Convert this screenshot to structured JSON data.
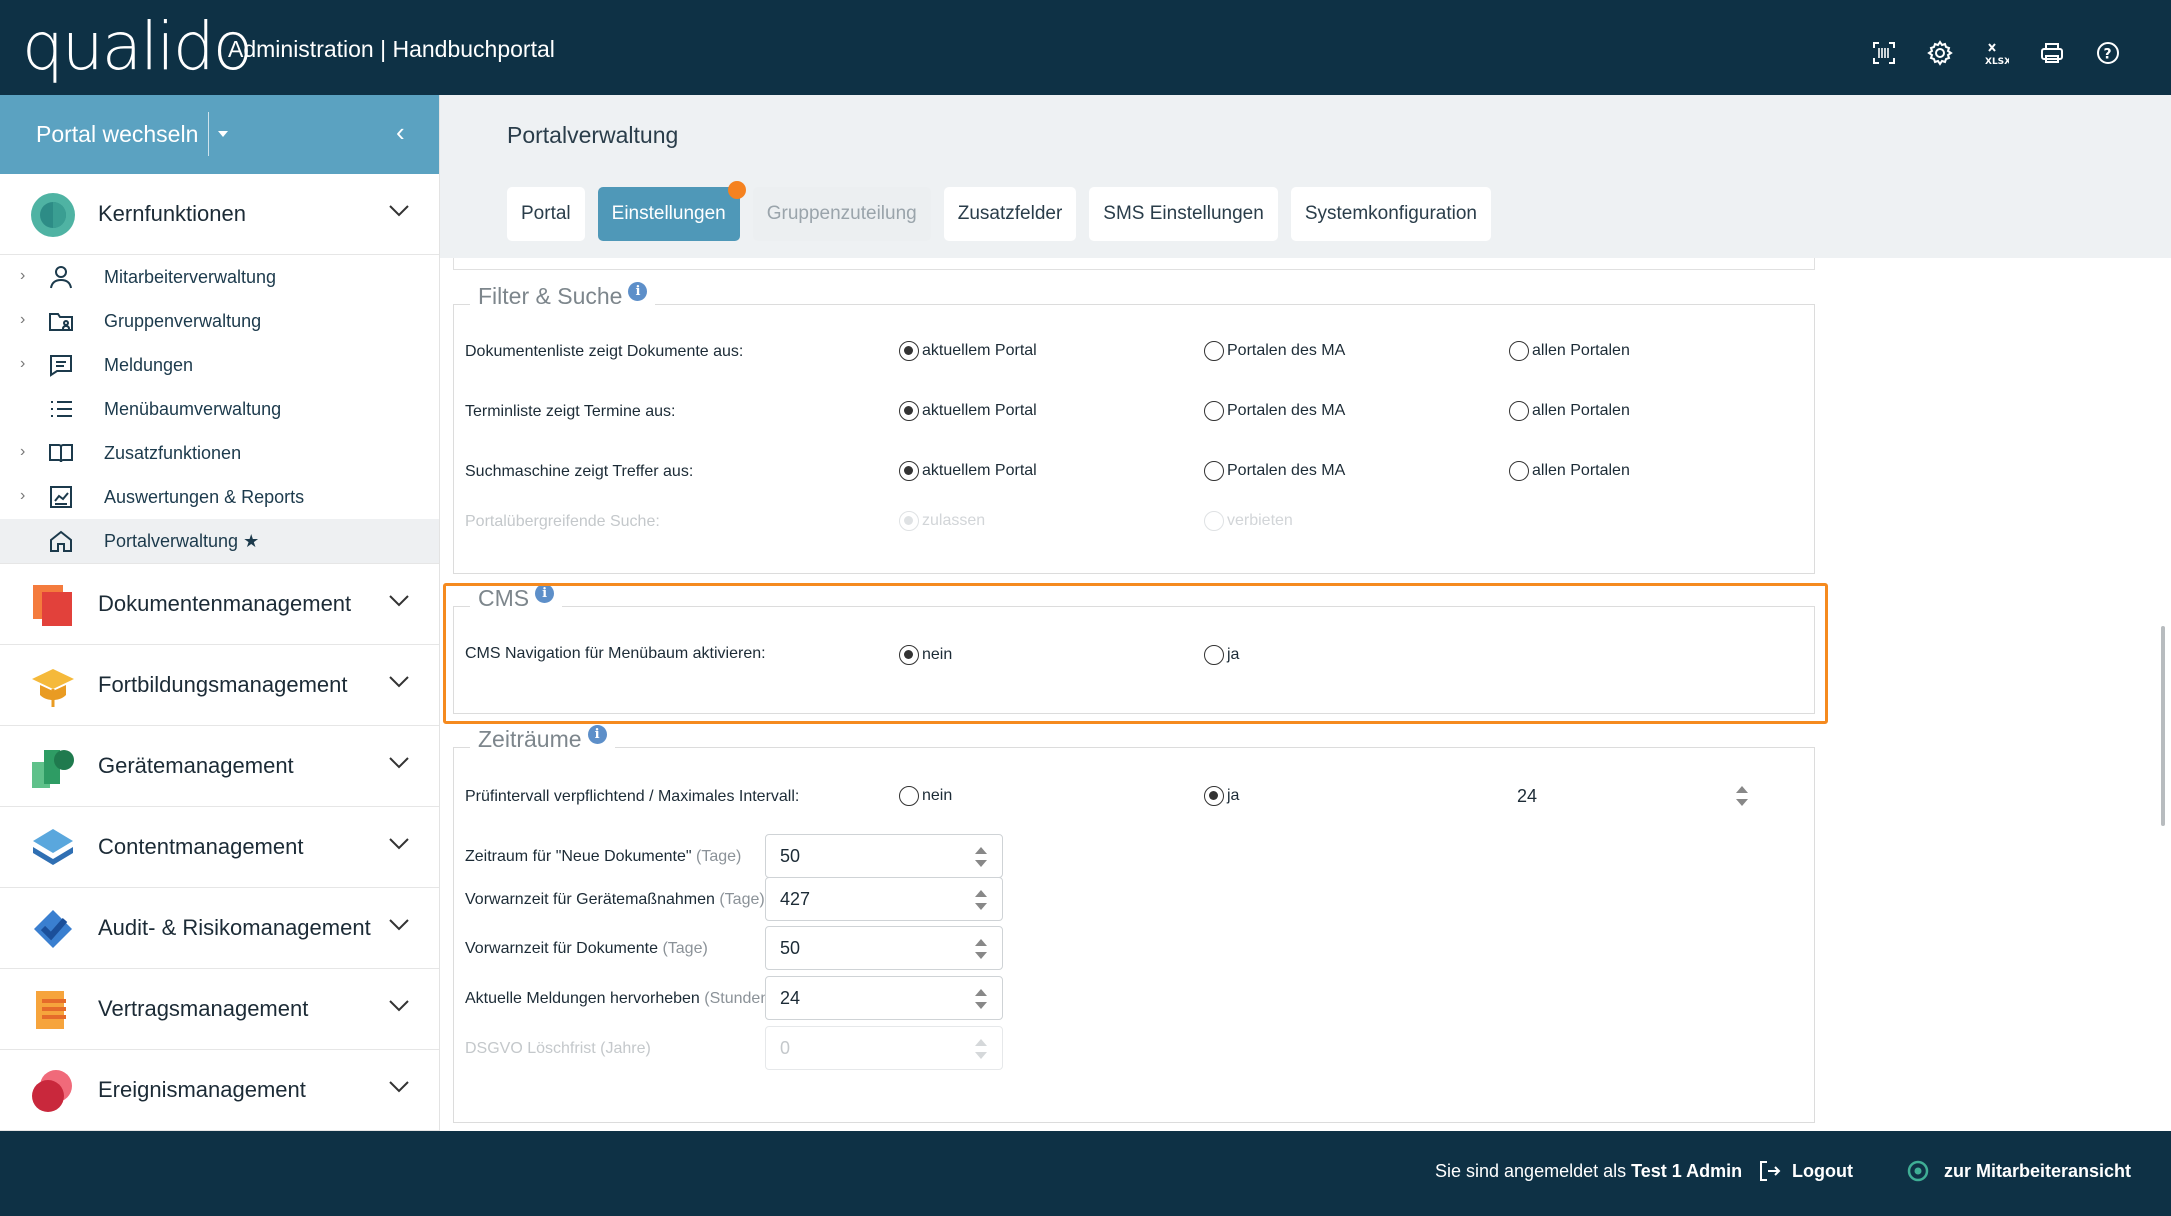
{
  "header": {
    "logo": "qualido",
    "title": "Administration | Handbuchportal",
    "icons": [
      "barcode-scan-icon",
      "gear-icon",
      "xlsx-export-icon",
      "printer-icon",
      "help-icon"
    ]
  },
  "sidebar": {
    "portal_switch": "Portal wechseln",
    "collapse": "‹",
    "kernfunktionen": {
      "label": "Kernfunktionen",
      "items": [
        {
          "label": "Mitarbeiterverwaltung",
          "icon": "person-icon",
          "expandable": true
        },
        {
          "label": "Gruppenverwaltung",
          "icon": "group-folder-icon",
          "expandable": true
        },
        {
          "label": "Meldungen",
          "icon": "message-icon",
          "expandable": true
        },
        {
          "label": "Menübaumverwaltung",
          "icon": "list-icon",
          "expandable": false
        },
        {
          "label": "Zusatzfunktionen",
          "icon": "book-icon",
          "expandable": true
        },
        {
          "label": "Auswertungen & Reports",
          "icon": "report-icon",
          "expandable": true
        },
        {
          "label": "Portalverwaltung ★",
          "icon": "home-icon",
          "expandable": false,
          "active": true
        }
      ]
    },
    "modules": [
      {
        "label": "Dokumentenmanagement",
        "icon": "dokumentenmanagement-icon",
        "color": "#e8563a"
      },
      {
        "label": "Fortbildungsmanagement",
        "icon": "fortbildungsmanagement-icon",
        "color": "#f2b233"
      },
      {
        "label": "Gerätemanagement",
        "icon": "geraetemanagement-icon",
        "color": "#3aa86b"
      },
      {
        "label": "Contentmanagement",
        "icon": "contentmanagement-icon",
        "color": "#3f86c2"
      },
      {
        "label": "Audit- & Risikomanagement",
        "icon": "audit-icon",
        "color": "#2f6fc4"
      },
      {
        "label": "Vertragsmanagement",
        "icon": "vertragsmanagement-icon",
        "color": "#f08a2c"
      },
      {
        "label": "Ereignismanagement",
        "icon": "ereignismanagement-icon",
        "color": "#d9384a"
      }
    ]
  },
  "page": {
    "title": "Portalverwaltung",
    "tabs": [
      {
        "label": "Portal",
        "state": "normal"
      },
      {
        "label": "Einstellungen",
        "state": "active"
      },
      {
        "label": "Gruppenzuteilung",
        "state": "disabled"
      },
      {
        "label": "Zusatzfelder",
        "state": "normal"
      },
      {
        "label": "SMS Einstellungen",
        "state": "normal"
      },
      {
        "label": "Systemkonfiguration",
        "state": "normal"
      }
    ]
  },
  "filter": {
    "legend": "Filter & Suche",
    "rows": [
      {
        "label": "Dokumentenliste zeigt Dokumente aus:",
        "options": [
          "aktuellem Portal",
          "Portalen des MA",
          "allen Portalen"
        ],
        "selected": 0
      },
      {
        "label": "Terminliste zeigt Termine aus:",
        "options": [
          "aktuellem Portal",
          "Portalen des MA",
          "allen Portalen"
        ],
        "selected": 0
      },
      {
        "label": "Suchmaschine zeigt Treffer aus:",
        "options": [
          "aktuellem Portal",
          "Portalen des MA",
          "allen Portalen"
        ],
        "selected": 0
      }
    ],
    "disabled_row": {
      "label": "Portalübergreifende Suche:",
      "options": [
        "zulassen",
        "verbieten"
      ],
      "selected": 0
    }
  },
  "cms": {
    "legend": "CMS",
    "row": {
      "label": "CMS Navigation für Menübaum aktivieren:",
      "options": [
        "nein",
        "ja"
      ],
      "selected": 0
    }
  },
  "zeitraeume": {
    "legend": "Zeiträume",
    "pruef": {
      "label": "Prüfintervall verpflichtend / Maximales Intervall:",
      "options": [
        "nein",
        "ja"
      ],
      "selected": 1,
      "value": "24"
    },
    "fields": [
      {
        "label": "Zeitraum für \"Neue Dokumente\"",
        "unit": "(Tage)",
        "value": "50"
      },
      {
        "label": "Vorwarnzeit für Gerätemaßnahmen",
        "unit": "(Tage)",
        "value": "427"
      },
      {
        "label": "Vorwarnzeit für Dokumente",
        "unit": "(Tage)",
        "value": "50"
      },
      {
        "label": "Aktuelle Meldungen hervorheben",
        "unit": "(Stunden)",
        "value": "24"
      }
    ],
    "disabled_field": {
      "label": "DSGVO Löschfrist",
      "unit": "(Jahre)",
      "value": "0"
    }
  },
  "footer": {
    "logged_in_prefix": "Sie sind angemeldet als ",
    "user": "Test 1 Admin",
    "logout": "Logout",
    "employee_view": "zur Mitarbeiteransicht"
  },
  "colors": {
    "header_bg": "#0e3145",
    "accent": "#4f98b8",
    "portal_switch_bg": "#5ba2c1",
    "highlight": "#f58a1f",
    "notification_dot": "#f58220"
  }
}
